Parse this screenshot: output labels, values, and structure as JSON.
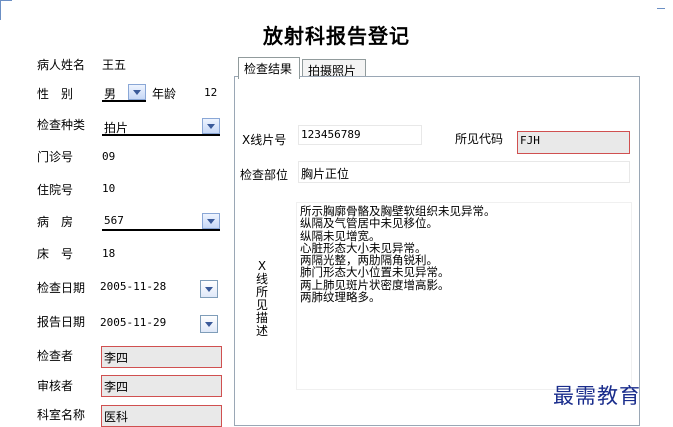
{
  "title": "放射科报告登记",
  "patient": {
    "name_label": "病人姓名",
    "name_value": "王五",
    "sex_label": "性　别",
    "sex_value": "男",
    "age_label": "年龄",
    "age_value": "12",
    "exam_type_label": "检查种类",
    "exam_type_value": "拍片",
    "clinic_label": "门诊号",
    "clinic_value": "09",
    "inpatient_label": "住院号",
    "inpatient_value": "10",
    "ward_label": "病　房",
    "ward_value": "567",
    "bed_label": "床　号",
    "bed_value": "18",
    "exam_date_label": "检查日期",
    "exam_date_value": "2005-11-28",
    "report_date_label": "报告日期",
    "report_date_value": "2005-11-29",
    "examiner_label": "检查者",
    "examiner_value": "李四",
    "reviewer_label": "审核者",
    "reviewer_value": "李四",
    "dept_label": "科室名称",
    "dept_value": "医科"
  },
  "tabs": [
    {
      "label": "检查结果"
    },
    {
      "label": "拍摄照片"
    }
  ],
  "result": {
    "xray_no_label": "X线片号",
    "xray_no_value": "123456789",
    "finding_code_label": "所见代码",
    "finding_code_value": "FJH",
    "part_label": "检查部位",
    "part_value": "胸片正位",
    "findings_label": "X线所见描述",
    "findings_text": "所示胸廓骨骼及胸壁软组织未见异常。\n纵隔及气管居中未见移位。\n纵隔未见增宽。\n心脏形态大小未见异常。\n两隔光整，两肋隔角锐利。\n肺门形态大小位置未见异常。\n两上肺见斑片状密度增高影。\n两肺纹理略多。"
  },
  "watermark": "最需教育",
  "colors": {
    "highlight_border": "#d05050",
    "watermark": "#1a2d8c",
    "accent": "#3a5a9a"
  }
}
